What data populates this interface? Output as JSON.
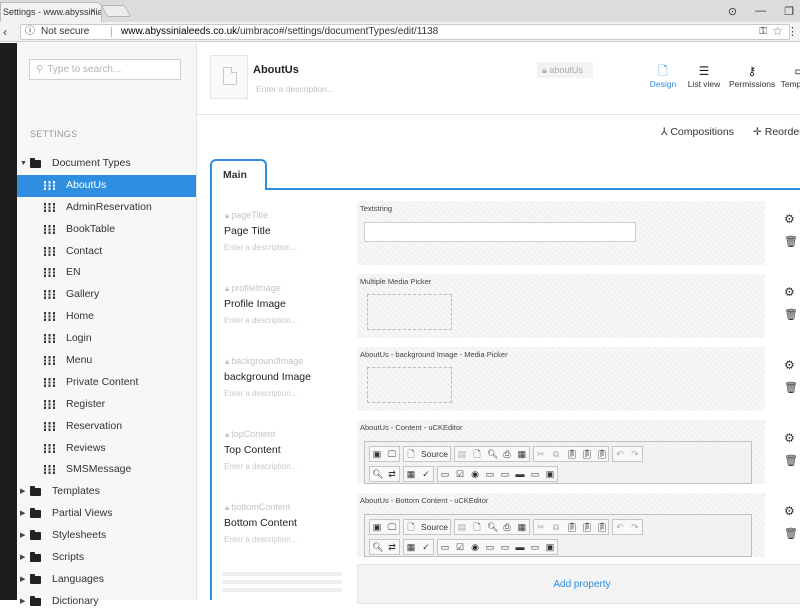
{
  "browser": {
    "tab_title": "Settings - www.abyssinial",
    "tab_close": "×",
    "not_secure": "Not secure",
    "url_domain": "www.abyssinialeeds.co.uk",
    "url_path": "/umbraco#/settings/documentTypes/edit/1138",
    "window_buttons": [
      "⊙",
      "—",
      "❐"
    ]
  },
  "sidebar": {
    "search_placeholder": "Type to search...",
    "section_label": "SETTINGS",
    "root": "Document Types",
    "children": [
      "AboutUs",
      "AdminReservation",
      "BookTable",
      "Contact",
      "EN",
      "Gallery",
      "Home",
      "Login",
      "Menu",
      "Private Content",
      "Register",
      "Reservation",
      "Reviews",
      "SMSMessage"
    ],
    "selected": "AboutUs",
    "folders": [
      "Templates",
      "Partial Views",
      "Stylesheets",
      "Scripts",
      "Languages",
      "Dictionary"
    ]
  },
  "header": {
    "name": "AboutUs",
    "alias": "aboutUs",
    "description_placeholder": "Enter a description...",
    "buttons": [
      {
        "label": "Design",
        "icon": "design-icon",
        "active": true
      },
      {
        "label": "List view",
        "icon": "list-view-icon",
        "active": false
      },
      {
        "label": "Permissions",
        "icon": "permissions-icon",
        "active": false
      },
      {
        "label": "Templates",
        "icon": "templates-icon",
        "active": false
      }
    ]
  },
  "actions": {
    "compositions": "Compositions",
    "reorder": "Reorder"
  },
  "tab": {
    "label": "Main"
  },
  "properties": [
    {
      "alias": "pageTitle",
      "name": "Page Title",
      "description": "Enter a description...",
      "editor": "Textstring",
      "kind": "textbox"
    },
    {
      "alias": "profileImage",
      "name": "Profile Image",
      "description": "Enter a description...",
      "editor": "Multiple Media Picker",
      "kind": "media"
    },
    {
      "alias": "backgroundImage",
      "name": "background Image",
      "description": "Enter a description...",
      "editor": "AboutUs - background Image - Media Picker",
      "kind": "media"
    },
    {
      "alias": "topContent",
      "name": "Top Content",
      "description": "Enter a description...",
      "editor": "AboutUs - Content - uCKEditor",
      "kind": "rte"
    },
    {
      "alias": "bottomContent",
      "name": "Bottom Content",
      "description": "Enter a description...",
      "editor": "AboutUs - Bottom Content - uCKEditor",
      "kind": "rte"
    }
  ],
  "cke": {
    "source_label": "Source"
  },
  "add_property": "Add property",
  "colors": {
    "accent": "#2e8ee0",
    "dark_strip": "#1d1d1d"
  }
}
